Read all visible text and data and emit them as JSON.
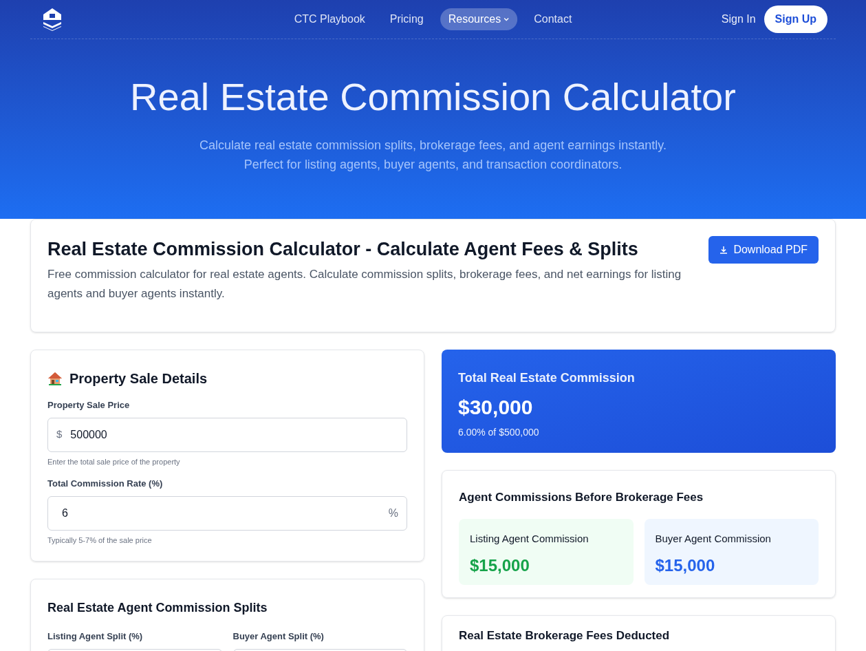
{
  "nav": {
    "links": [
      {
        "label": "CTC Playbook",
        "selected": false,
        "dropdown": false
      },
      {
        "label": "Pricing",
        "selected": false,
        "dropdown": false
      },
      {
        "label": "Resources",
        "selected": true,
        "dropdown": true
      },
      {
        "label": "Contact",
        "selected": false,
        "dropdown": false
      }
    ],
    "sign_in": "Sign In",
    "sign_up": "Sign Up"
  },
  "hero": {
    "title": "Real Estate Commission Calculator",
    "subtitle_lines": [
      "Calculate real estate commission splits, brokerage fees, and agent earnings instantly.",
      "Perfect for listing agents, buyer agents, and transaction coordinators."
    ]
  },
  "intro": {
    "title": "Real Estate Commission Calculator - Calculate Agent Fees & Splits",
    "description": "Free commission calculator for real estate agents. Calculate commission splits, brokerage fees, and net earnings for listing agents and buyer agents instantly.",
    "download_button": "Download PDF"
  },
  "sale_details": {
    "title": "Property Sale Details",
    "fields": [
      {
        "label": "Property Sale Price",
        "prefix": "$",
        "value": "500000",
        "hint": "Enter the total sale price of the property"
      },
      {
        "label": "Total Commission Rate (%)",
        "suffix": "%",
        "value": "6",
        "hint": "Typically 5-7% of the sale price"
      }
    ]
  },
  "splits": {
    "title": "Real Estate Agent Commission Splits",
    "fields": [
      {
        "label": "Listing Agent Split (%)"
      },
      {
        "label": "Buyer Agent Split (%)"
      }
    ]
  },
  "total": {
    "title": "Total Real Estate Commission",
    "amount": "$30,000",
    "detail": "6.00% of $500,000"
  },
  "agent_commissions": {
    "title": "Agent Commissions Before Brokerage Fees",
    "items": [
      {
        "label": "Listing Agent Commission",
        "amount": "$15,000",
        "color": "#16a34a"
      },
      {
        "label": "Buyer Agent Commission",
        "amount": "$15,000",
        "color": "#2563eb"
      }
    ]
  },
  "brokerage": {
    "title": "Real Estate Brokerage Fees Deducted"
  }
}
